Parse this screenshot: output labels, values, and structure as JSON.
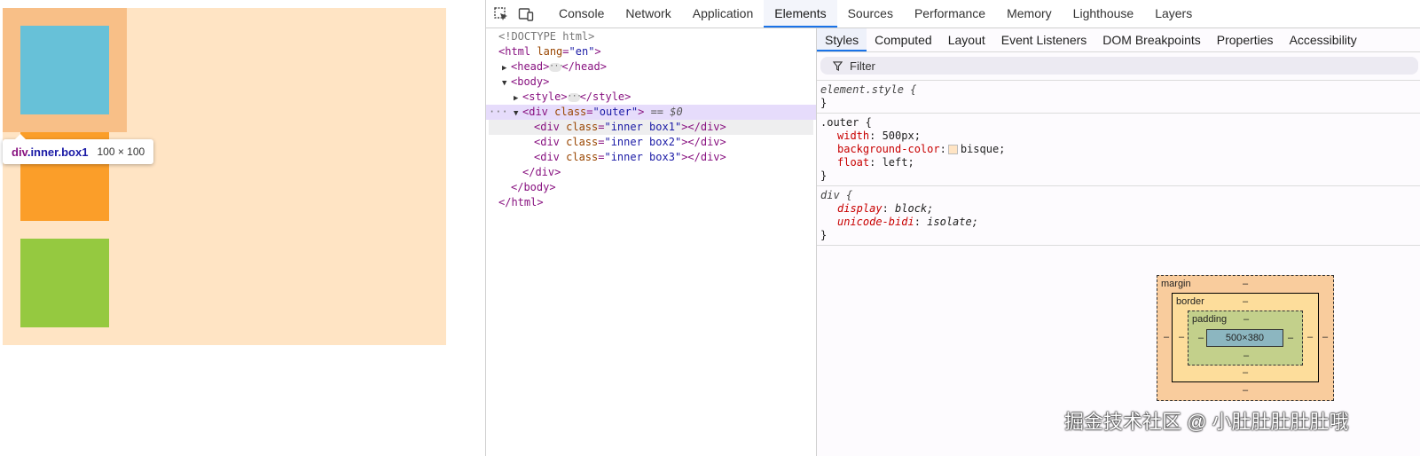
{
  "preview": {
    "tooltip_selector": "div",
    "tooltip_class": ".inner.box1",
    "tooltip_size": "100 × 100"
  },
  "devtools": {
    "tabs": [
      "Console",
      "Network",
      "Application",
      "Elements",
      "Sources",
      "Performance",
      "Memory",
      "Lighthouse",
      "Layers"
    ],
    "active_tab": "Elements",
    "dom": {
      "doctype": "<!DOCTYPE html>",
      "html_open_tag": "html",
      "html_lang_attr": "lang",
      "html_lang_val": "\"en\"",
      "head_open": "<head>",
      "head_close": "</head>",
      "body_open": "<body>",
      "style_open": "<style>",
      "style_close": "</style>",
      "outer_tag": "div",
      "outer_attr": "class",
      "outer_val": "\"outer\"",
      "outer_marker": "== $0",
      "row_dots": "···",
      "children": [
        {
          "attr": "class",
          "val": "\"inner box1\""
        },
        {
          "attr": "class",
          "val": "\"inner box2\""
        },
        {
          "attr": "class",
          "val": "\"inner box3\""
        }
      ],
      "div_close": "</div>",
      "body_close": "</body>",
      "html_close": "</html>"
    },
    "subtabs": [
      "Styles",
      "Computed",
      "Layout",
      "Event Listeners",
      "DOM Breakpoints",
      "Properties",
      "Accessibility"
    ],
    "active_subtab": "Styles",
    "filter_placeholder": "Filter",
    "rules": {
      "element_style": "element.style {",
      "close_brace": "}",
      "outer_selector": ".outer {",
      "outer_props": [
        {
          "name": "width",
          "value": "500px;"
        },
        {
          "name": "background-color",
          "value": "bisque;"
        },
        {
          "name": "float",
          "value": "left;"
        }
      ],
      "div_selector": "div {",
      "div_props": [
        {
          "name": "display",
          "value": "block;"
        },
        {
          "name": "unicode-bidi",
          "value": "isolate;"
        }
      ]
    },
    "box_model": {
      "margin_label": "margin",
      "border_label": "border",
      "padding_label": "padding",
      "content_size": "500×380",
      "dash": "–"
    }
  },
  "watermark": "掘金技术社区 @ 小肚肚肚肚肚哦",
  "colors": {
    "outer_bg": "#ffe4c4",
    "box1": "#67c1d8",
    "box2": "#fb9e29",
    "box3": "#95c940",
    "highlight_margin": "#f8bf87",
    "accent": "#1a73e8"
  }
}
